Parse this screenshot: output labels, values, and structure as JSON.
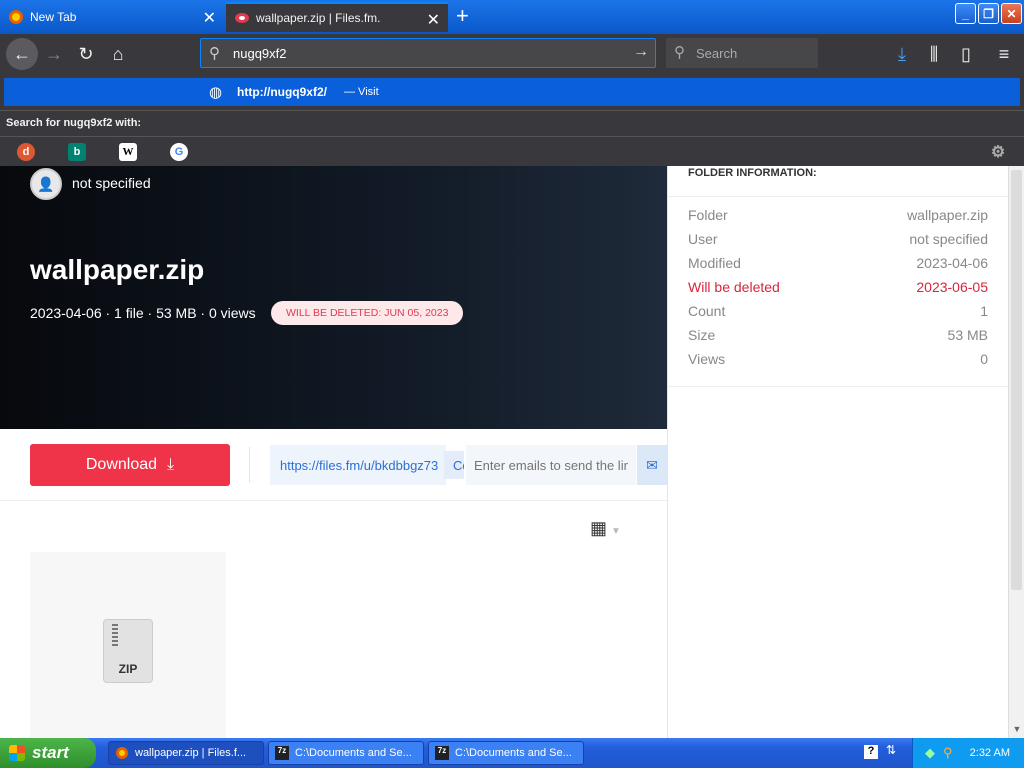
{
  "browser": {
    "tabs": [
      {
        "title": "New Tab",
        "active": false
      },
      {
        "title": "wallpaper.zip | Files.fm.",
        "active": true
      }
    ],
    "url_value": "nugq9xf2",
    "search_placeholder": "Search",
    "suggestion": {
      "url": "http://nugq9xf2/",
      "action": "— Visit"
    },
    "search_with_label": "Search for nugq9xf2 with:",
    "engines": [
      "duckduckgo-icon",
      "bing-icon",
      "wikipedia-icon",
      "google-icon"
    ]
  },
  "page": {
    "owner": "not specified",
    "file_title": "wallpaper.zip",
    "meta_line": "2023-04-06 · 1 file · 53 MB · 0 views",
    "delete_badge": "WILL BE DELETED: JUN 05, 2023",
    "download_label": "Download",
    "share_link": "https://files.fm/u/bkdbbgz73",
    "copy_label": "Co",
    "email_placeholder": "Enter emails to send the link",
    "file_type": "ZIP",
    "accent_color": "#ef3348"
  },
  "panel": {
    "heading": "FOLDER INFORMATION:",
    "rows": [
      {
        "label": "Folder",
        "value": "wallpaper.zip"
      },
      {
        "label": "User",
        "value": "not specified"
      },
      {
        "label": "Modified",
        "value": "2023-04-06"
      },
      {
        "label": "Will be deleted",
        "value": "2023-06-05"
      },
      {
        "label": "Count",
        "value": "1"
      },
      {
        "label": "Size",
        "value": "53 MB"
      },
      {
        "label": "Views",
        "value": "0"
      }
    ]
  },
  "taskbar": {
    "start_label": "start",
    "tasks": [
      "wallpaper.zip | Files.f...",
      "C:\\Documents and Se...",
      "C:\\Documents and Se..."
    ],
    "clock": "2:32 AM"
  }
}
